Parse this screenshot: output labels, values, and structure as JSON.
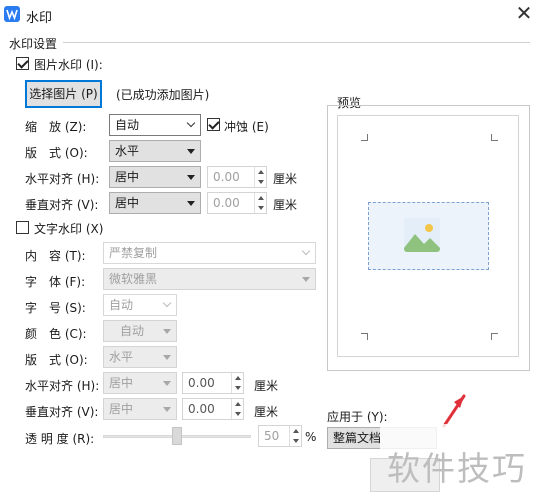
{
  "window": {
    "title": "水印",
    "close_glyph": "✕"
  },
  "section_title": "水印设置",
  "image_watermark": {
    "checkbox_label": "图片水印 (I):",
    "checked": true,
    "select_button": "选择图片 (P)",
    "status_text": "(已成功添加图片)",
    "scale_label": "缩　放 (Z):",
    "scale_value": "自动",
    "washout_label": "冲蚀 (E)",
    "washout_checked": true,
    "layout_label": "版　式 (O):",
    "layout_value": "水平",
    "h_align_label": "水平对齐 (H):",
    "h_align_value": "居中",
    "h_offset": "0.00",
    "h_unit": "厘米",
    "v_align_label": "垂直对齐 (V):",
    "v_align_value": "居中",
    "v_offset": "0.00",
    "v_unit": "厘米"
  },
  "text_watermark": {
    "checkbox_label": "文字水印 (X)",
    "checked": false,
    "content_label": "内　容 (T):",
    "content_value": "严禁复制",
    "font_label": "字　体 (F):",
    "font_value": "微软雅黑",
    "size_label": "字　号 (S):",
    "size_value": "自动",
    "color_label": "颜　色 (C):",
    "color_value": "自动",
    "layout_label": "版　式 (O):",
    "layout_value": "水平",
    "h_align_label": "水平对齐 (H):",
    "h_align_value": "居中",
    "h_offset": "0.00",
    "h_unit": "厘米",
    "v_align_label": "垂直对齐 (V):",
    "v_align_value": "居中",
    "v_offset": "0.00",
    "v_unit": "厘米",
    "transparency_label": "透 明 度 (R):",
    "transparency_value": "50",
    "transparency_unit": "%"
  },
  "preview": {
    "label": "预览"
  },
  "apply": {
    "label": "应用于 (Y):",
    "value": "整篇文档"
  },
  "overlay_watermark": "软件技巧",
  "colors": {
    "accent": "#0078d7",
    "app_icon": "#2b7cf0",
    "arrow_mark": "#e0303a"
  },
  "icons": [
    "wps-app-icon",
    "close-icon",
    "image-placeholder-icon",
    "dropdown-arrow-icon",
    "checkmark-icon"
  ]
}
